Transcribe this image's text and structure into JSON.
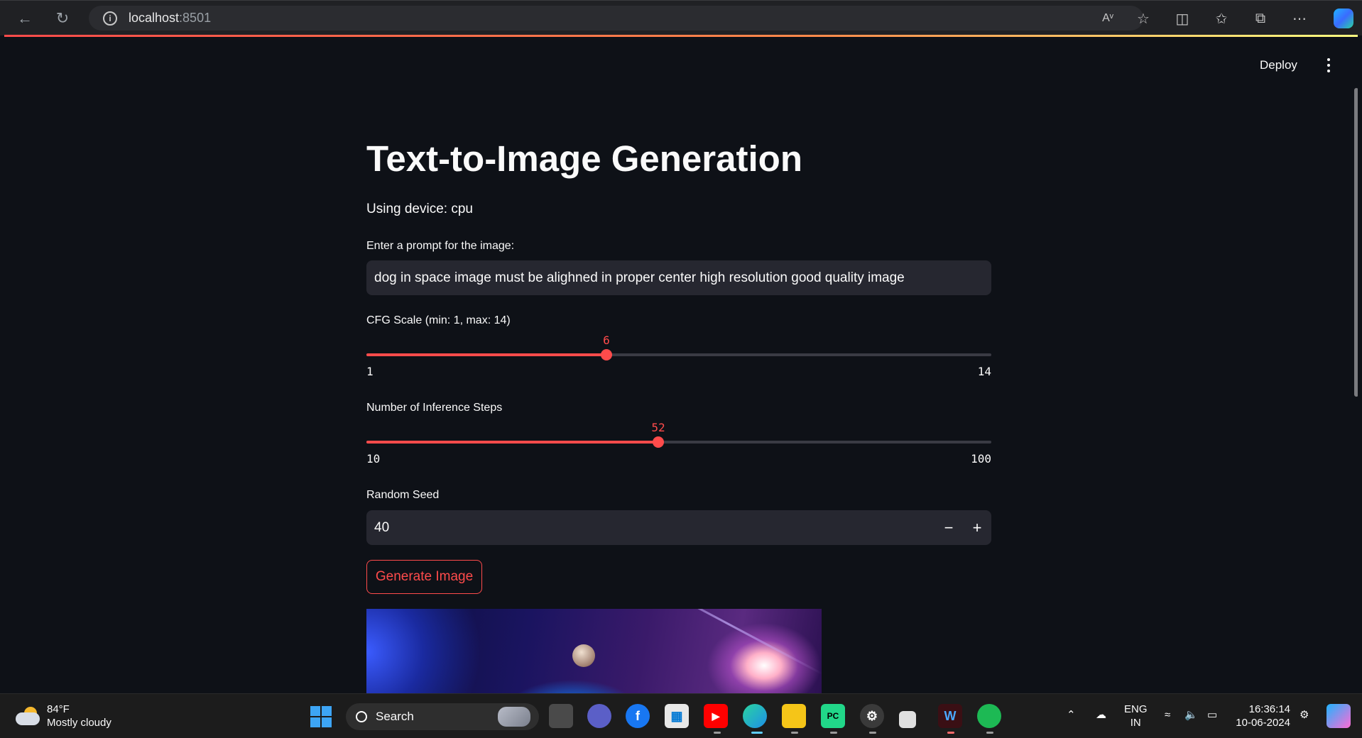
{
  "browser": {
    "url_host": "localhost",
    "url_port": ":8501",
    "copilot_icon": "copilot-icon",
    "accent": "#ff4b4b"
  },
  "header": {
    "deploy_label": "Deploy"
  },
  "main": {
    "title": "Text-to-Image Generation",
    "device_text": "Using device: cpu",
    "prompt_label": "Enter a prompt for the image:",
    "prompt_value": "dog in space image must be alighned in proper center  high resolution good quality image",
    "cfg": {
      "label": "CFG Scale (min: 1, max: 14)",
      "value": 6,
      "min": 1,
      "max": 14,
      "value_text": "6",
      "min_text": "1",
      "max_text": "14"
    },
    "steps": {
      "label": "Number of Inference Steps",
      "value": 52,
      "min": 10,
      "max": 100,
      "value_text": "52",
      "min_text": "10",
      "max_text": "100"
    },
    "seed": {
      "label": "Random Seed",
      "value": "40",
      "minus": "−",
      "plus": "+"
    },
    "generate_label": "Generate Image"
  },
  "taskbar": {
    "weather_temp": "84°F",
    "weather_desc": "Mostly cloudy",
    "search_label": "Search",
    "lang_top": "ENG",
    "lang_bottom": "IN",
    "time": "16:36:14",
    "date": "10-06-2024"
  }
}
